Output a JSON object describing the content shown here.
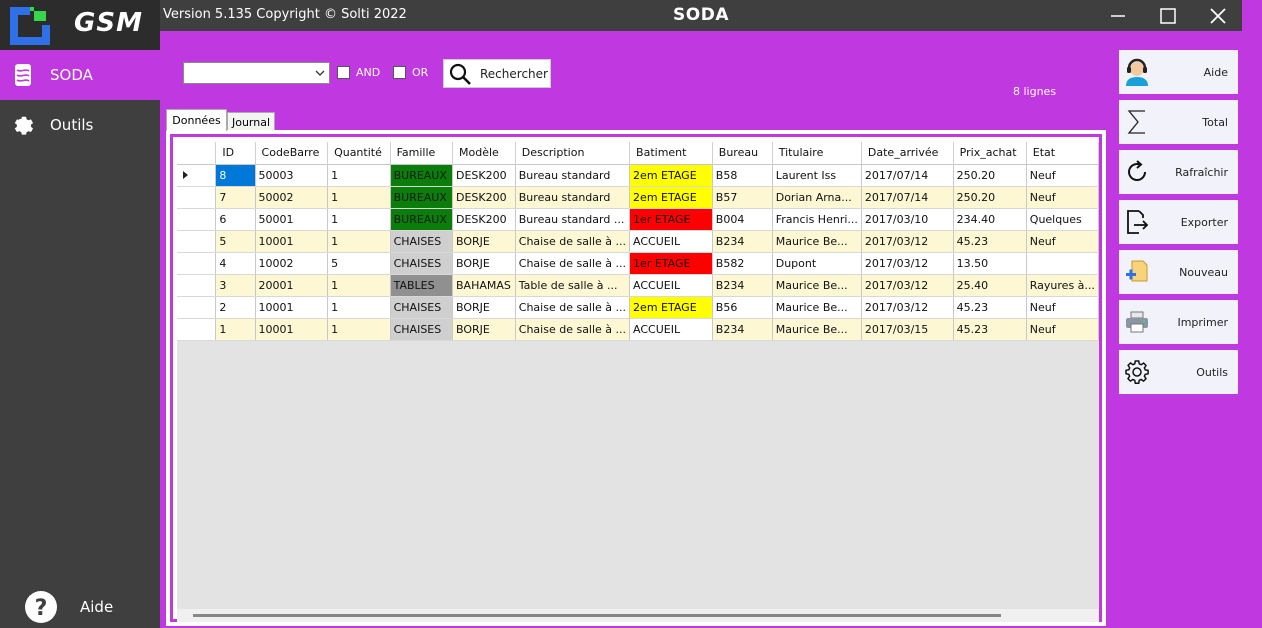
{
  "app": {
    "version_text": "Version 5.135  Copyright © Solti 2022",
    "title": "SODA",
    "logo_text": "GSM"
  },
  "sidebar": {
    "items": [
      {
        "label": "SODA",
        "icon": "soda-can-icon",
        "active": true
      },
      {
        "label": "Outils",
        "icon": "gear-icon",
        "active": false
      }
    ],
    "help_label": "Aide"
  },
  "search": {
    "combo_value": "",
    "and_label": "AND",
    "or_label": "OR",
    "button_label": "Rechercher"
  },
  "row_count": "8 lignes",
  "tabs": [
    {
      "label": "Données",
      "active": true
    },
    {
      "label": "Journal",
      "active": false
    }
  ],
  "table": {
    "columns": [
      "ID",
      "CodeBarre",
      "Quantité",
      "Famille",
      "Modèle",
      "Description",
      "Batiment",
      "Bureau",
      "Titulaire",
      "Date_arrivée",
      "Prix_achat",
      "Etat"
    ],
    "rows": [
      [
        "8",
        "50003",
        "1",
        "BUREAUX",
        "DESK200",
        "Bureau standard",
        "2em ETAGE",
        "B58",
        "Laurent Iss",
        "2017/07/14",
        "250.20",
        "Neuf"
      ],
      [
        "7",
        "50002",
        "1",
        "BUREAUX",
        "DESK200",
        "Bureau standard",
        "2em ETAGE",
        "B57",
        "Dorian Arna...",
        "2017/07/14",
        "250.20",
        "Neuf"
      ],
      [
        "6",
        "50001",
        "1",
        "BUREAUX",
        "DESK200",
        "Bureau standard ...",
        "1er ETAGE",
        "B004",
        "Francis Henri...",
        "2017/03/10",
        "234.40",
        "Quelques"
      ],
      [
        "5",
        "10001",
        "1",
        "CHAISES",
        "BORJE",
        "Chaise de salle à ...",
        "ACCUEIL",
        "B234",
        "Maurice Be...",
        "2017/03/12",
        "45.23",
        "Neuf"
      ],
      [
        "4",
        "10002",
        "5",
        "CHAISES",
        "BORJE",
        "Chaise de salle à ...",
        "1er ETAGE",
        "B582",
        "Dupont",
        "2017/03/12",
        "13.50",
        ""
      ],
      [
        "3",
        "20001",
        "1",
        "TABLES",
        "BAHAMAS",
        "Table de salle à ...",
        "ACCUEIL",
        "B234",
        "Maurice Be...",
        "2017/03/12",
        "25.40",
        "Rayures à..."
      ],
      [
        "2",
        "10001",
        "1",
        "CHAISES",
        "BORJE",
        "Chaise de salle à ...",
        "2em ETAGE",
        "B56",
        "Maurice Be...",
        "2017/03/12",
        "45.23",
        "Neuf"
      ],
      [
        "1",
        "10001",
        "1",
        "CHAISES",
        "BORJE",
        "Chaise de salle à ...",
        "ACCUEIL",
        "B234",
        "Maurice Be...",
        "2017/03/15",
        "45.23",
        "Neuf"
      ]
    ]
  },
  "actions": [
    {
      "label": "Aide",
      "icon": "support-agent-icon"
    },
    {
      "label": "Total",
      "icon": "sigma-icon"
    },
    {
      "label": "Rafraîchir",
      "icon": "refresh-icon"
    },
    {
      "label": "Exporter",
      "icon": "export-icon"
    },
    {
      "label": "Nouveau",
      "icon": "new-document-icon"
    },
    {
      "label": "Imprimer",
      "icon": "printer-icon"
    },
    {
      "label": "Outils",
      "icon": "gear-icon"
    }
  ],
  "colors": {
    "accent": "#c038e0",
    "sidebar": "#3f3f3f",
    "selection": "#0078d7",
    "famille_bureaux": "#0a7d0a",
    "famille_chaises": "#cfcfcf",
    "famille_tables": "#909090",
    "batiment_2em": "#ffff00",
    "batiment_1er": "#ff0000"
  }
}
